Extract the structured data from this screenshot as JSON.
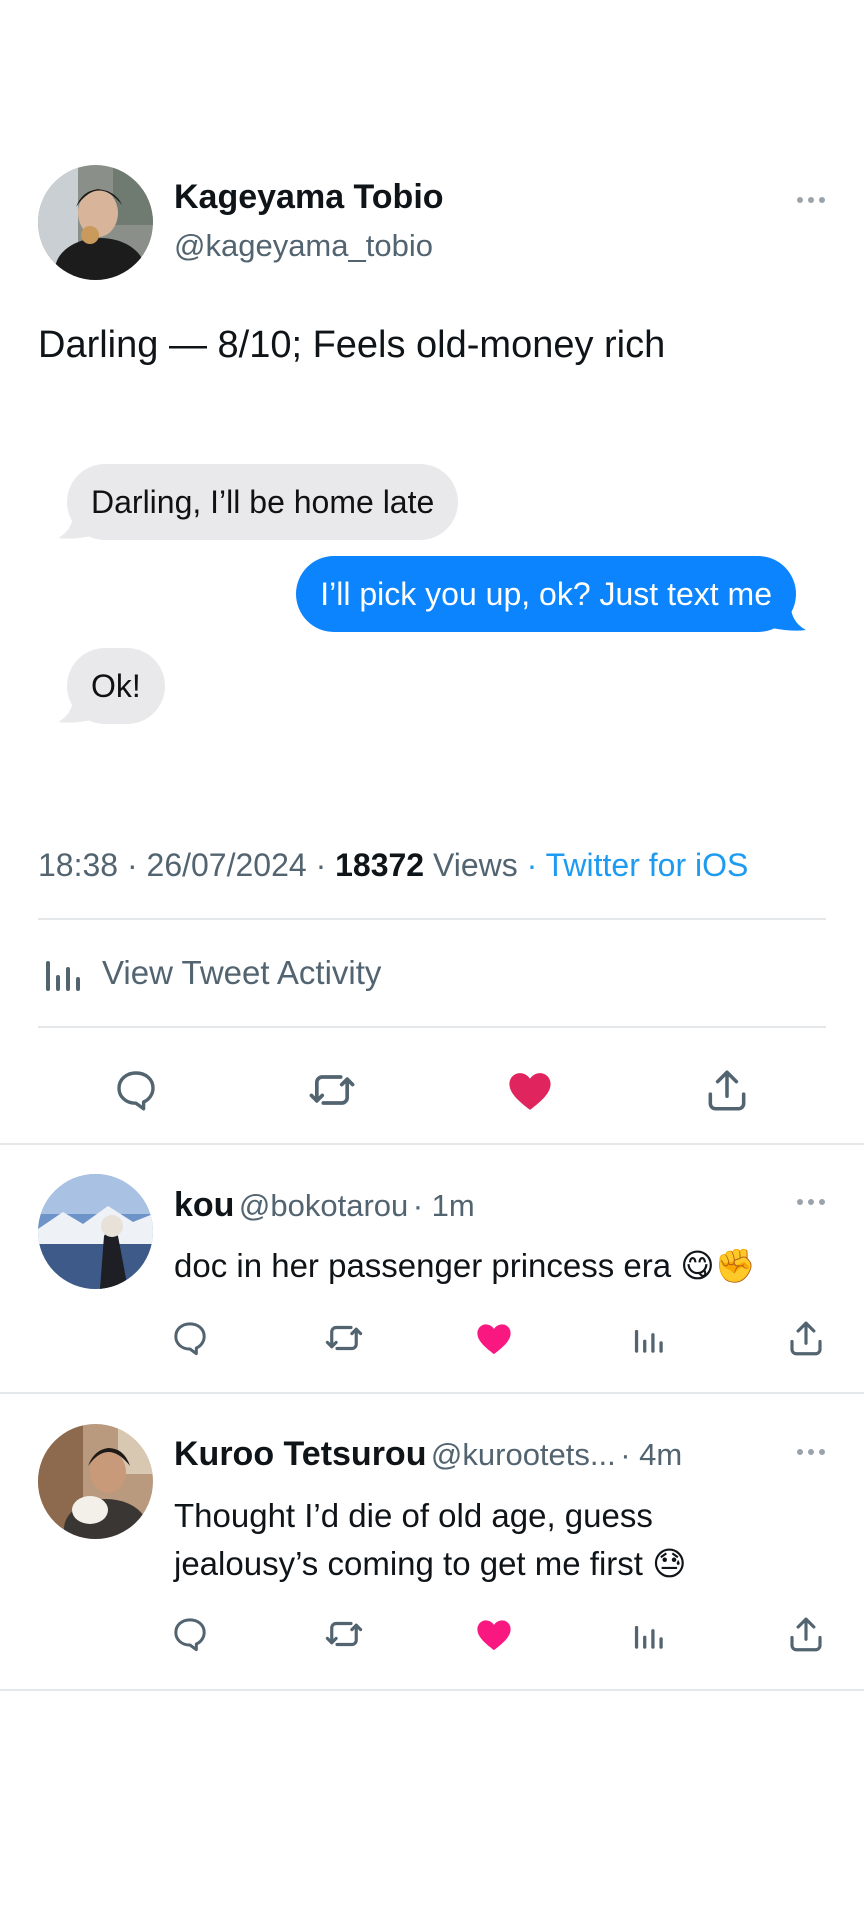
{
  "tweet": {
    "author_name": "Kageyama Tobio",
    "author_handle": "@kageyama_tobio",
    "text": "Darling — 8/10; Feels old-money rich",
    "messages": [
      {
        "side": "in",
        "text": "Darling, I’ll be home late"
      },
      {
        "side": "out",
        "text": "I’ll pick you up, ok? Just text me"
      },
      {
        "side": "in",
        "text": "Ok!"
      }
    ],
    "time": "18:38",
    "date": "26/07/2024",
    "views_count": "18372",
    "views_label": "Views",
    "source": "Twitter for iOS",
    "activity_label": "View Tweet Activity",
    "liked": true
  },
  "replies": [
    {
      "name": "kou",
      "handle": "@bokotarou",
      "time": "1m",
      "text": "doc in her passenger princess era 😋✊",
      "liked": true
    },
    {
      "name": "Kuroo Tetsurou",
      "handle": "@kurootets...",
      "time": "4m",
      "text_line1": "Thought I’d die of old age, guess",
      "text_line2": "jealousy’s coming to get me first 😓",
      "liked": true
    }
  ],
  "colors": {
    "like_main": "#e0245e",
    "like_reply": "#f91880",
    "imessage_blue": "#0b84fe",
    "imessage_gray": "#e9e9eb",
    "link_blue": "#1d9bf0",
    "secondary_text": "#536471"
  },
  "icons": [
    "reply-icon",
    "retweet-icon",
    "heart-icon",
    "share-icon",
    "analytics-icon",
    "more-icon"
  ]
}
